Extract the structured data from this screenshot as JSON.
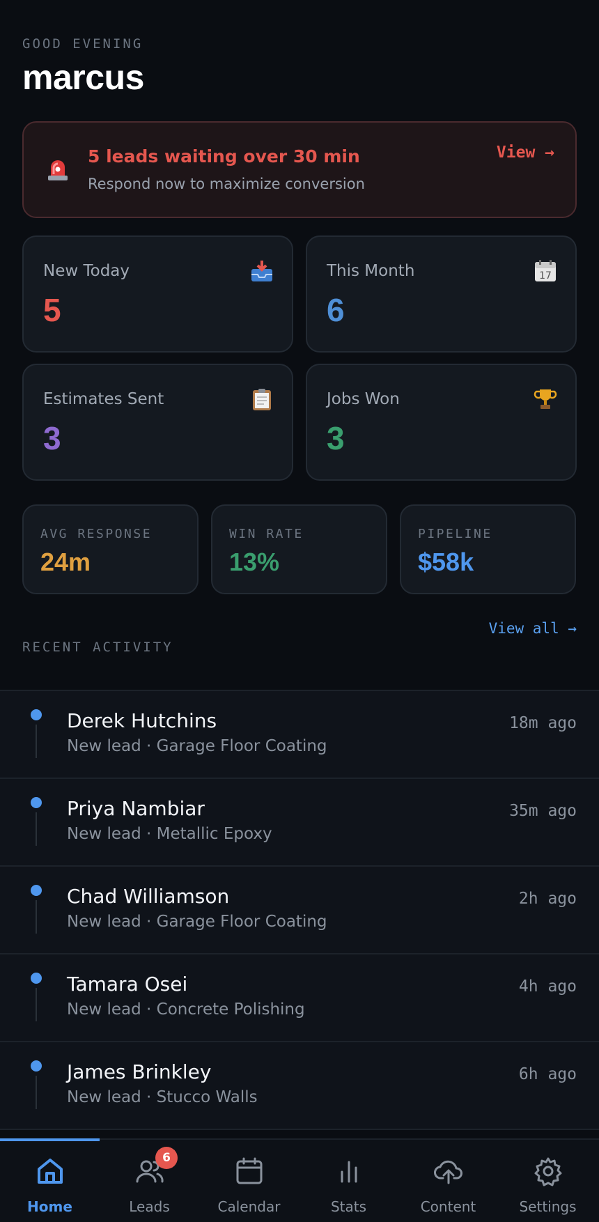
{
  "header": {
    "greeting": "GOOD EVENING",
    "user_name": "marcus"
  },
  "alert": {
    "icon": "siren-icon",
    "title": "5 leads waiting over 30 min",
    "subtitle": "Respond now to maximize conversion",
    "link_label": "View →",
    "color": "#e5574f"
  },
  "stats": [
    {
      "label": "New Today",
      "value": "5",
      "icon": "inbox-tray-icon",
      "color": "#e5574f"
    },
    {
      "label": "This Month",
      "value": "6",
      "icon": "calendar-icon",
      "color": "#4f8fd6"
    },
    {
      "label": "Estimates Sent",
      "value": "3",
      "icon": "clipboard-icon",
      "color": "#8e6ad0"
    },
    {
      "label": "Jobs Won",
      "value": "3",
      "icon": "trophy-icon",
      "color": "#3a9e6e"
    }
  ],
  "metrics": [
    {
      "label": "AVG RESPONSE",
      "value": "24m",
      "color": "#e0a040"
    },
    {
      "label": "WIN RATE",
      "value": "13%",
      "color": "#3a9e6e"
    },
    {
      "label": "PIPELINE",
      "value": "$58k",
      "color": "#4f97ee"
    }
  ],
  "recent_activity": {
    "title": "RECENT ACTIVITY",
    "view_all_label": "View all →",
    "items": [
      {
        "name": "Derek Hutchins",
        "detail": "New lead · Garage Floor Coating",
        "time": "18m ago"
      },
      {
        "name": "Priya Nambiar",
        "detail": "New lead · Metallic Epoxy",
        "time": "35m ago"
      },
      {
        "name": "Chad Williamson",
        "detail": "New lead · Garage Floor Coating",
        "time": "2h ago"
      },
      {
        "name": "Tamara Osei",
        "detail": "New lead · Concrete Polishing",
        "time": "4h ago"
      },
      {
        "name": "James Brinkley",
        "detail": "New lead · Stucco Walls",
        "time": "6h ago"
      }
    ]
  },
  "nav": {
    "items": [
      {
        "label": "Home",
        "icon": "home-icon",
        "active": true
      },
      {
        "label": "Leads",
        "icon": "users-icon",
        "badge": "6"
      },
      {
        "label": "Calendar",
        "icon": "calendar-icon"
      },
      {
        "label": "Stats",
        "icon": "bar-chart-icon"
      },
      {
        "label": "Content",
        "icon": "cloud-upload-icon"
      },
      {
        "label": "Settings",
        "icon": "gear-icon"
      }
    ],
    "accent_color": "#4f97ee"
  }
}
